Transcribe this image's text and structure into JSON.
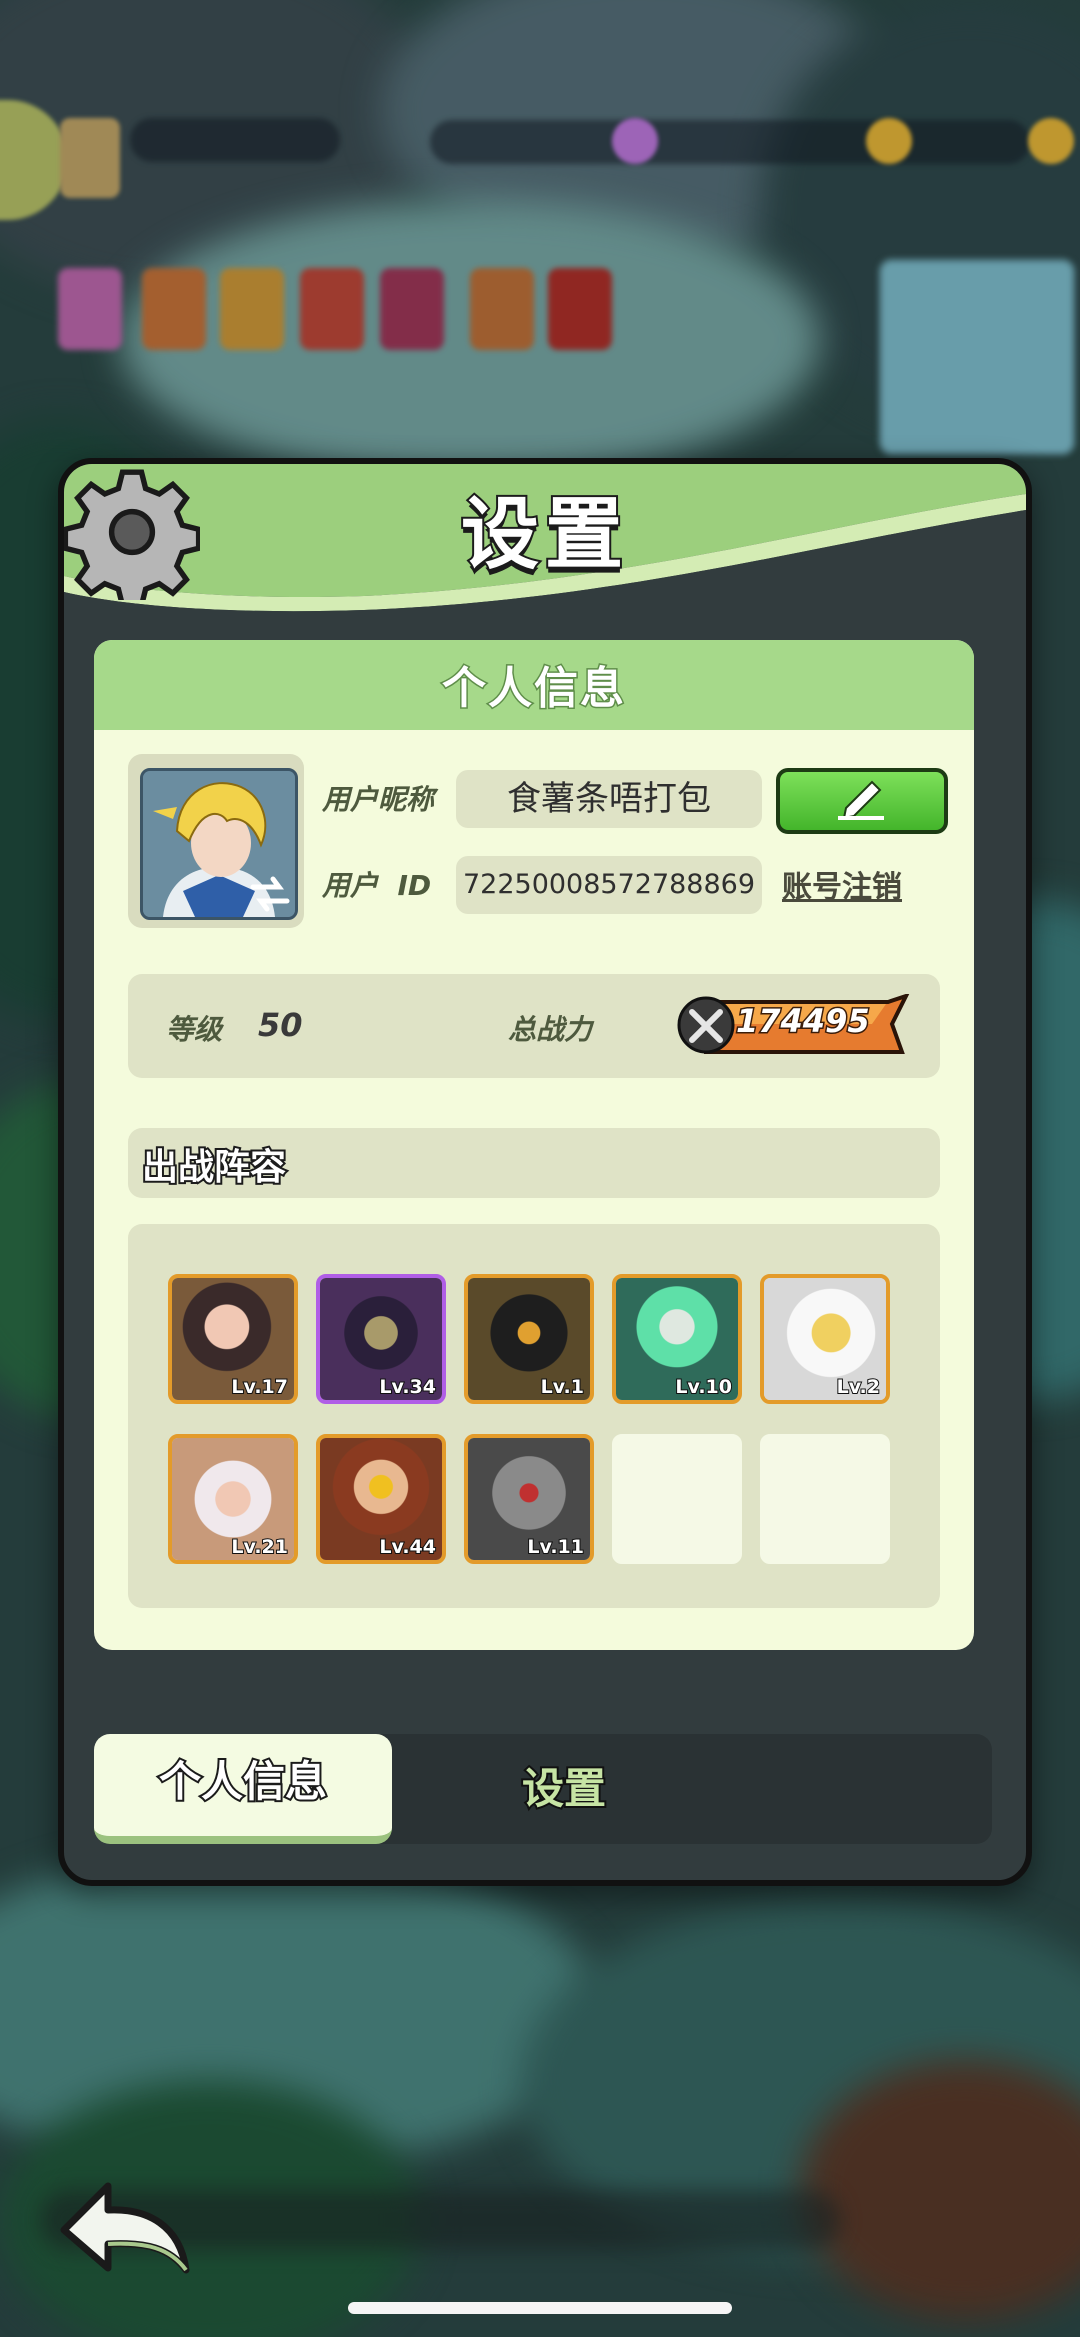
{
  "dialog": {
    "title": "设置",
    "panel_title": "个人信息"
  },
  "profile": {
    "nickname_label": "用户昵称",
    "nickname": "食薯条唔打包",
    "id_label": "用户  ID",
    "user_id": "72250008572788869",
    "delete_account": "账号注销",
    "level_label": "等级",
    "level": "50",
    "power_label": "总战力",
    "power": "174495"
  },
  "lineup": {
    "title": "出战阵容",
    "heroes": [
      {
        "level": "Lv.17",
        "rarity": "orange",
        "color": "#7a5a3a"
      },
      {
        "level": "Lv.34",
        "rarity": "purple",
        "color": "#4a2f5c"
      },
      {
        "level": "Lv.1",
        "rarity": "orange",
        "color": "#5a4a2a"
      },
      {
        "level": "Lv.10",
        "rarity": "orange",
        "color": "#2f6b5a"
      },
      {
        "level": "Lv.2",
        "rarity": "orange",
        "color": "#d8d8d8"
      },
      {
        "level": "Lv.21",
        "rarity": "orange",
        "color": "#c89a7a"
      },
      {
        "level": "Lv.44",
        "rarity": "orange",
        "color": "#7a3a22"
      },
      {
        "level": "Lv.11",
        "rarity": "orange",
        "color": "#4a4a4a"
      }
    ],
    "empty_slots": 2
  },
  "tabs": {
    "active": "个人信息",
    "inactive": "设置"
  },
  "colors": {
    "header_green": "#9ccf7d",
    "panel_bg": "#f4fbdc",
    "border_orange": "#e39b2a",
    "border_purple": "#b05ee6"
  }
}
